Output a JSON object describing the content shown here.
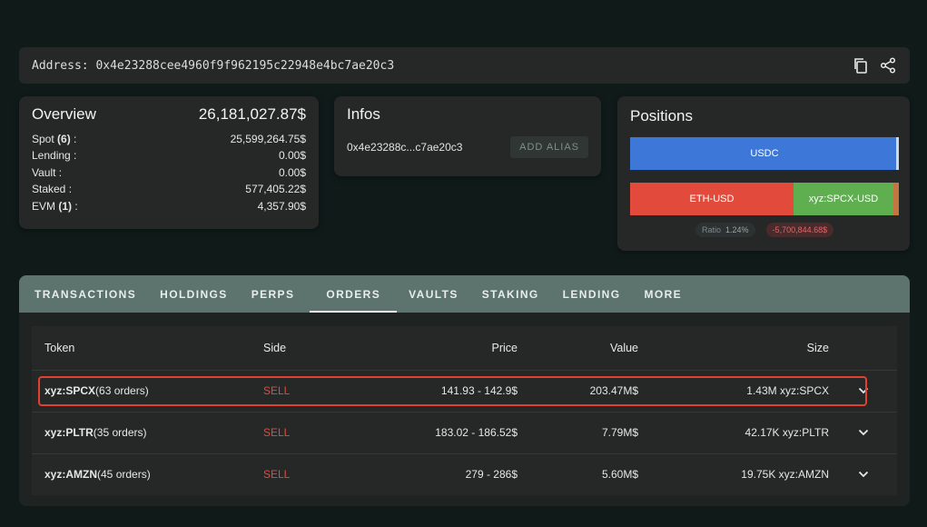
{
  "address": {
    "label": "Address: 0x4e23288cee4960f9f962195c22948e4bc7ae20c3"
  },
  "overview": {
    "title": "Overview",
    "total": "26,181,027.87$",
    "rows": [
      {
        "label_pre": "Spot ",
        "count": "(6)",
        "label_post": " :",
        "value": "25,599,264.75$"
      },
      {
        "label_pre": "Lending :",
        "count": "",
        "label_post": "",
        "value": "0.00$"
      },
      {
        "label_pre": "Vault :",
        "count": "",
        "label_post": "",
        "value": "0.00$"
      },
      {
        "label_pre": "Staked :",
        "count": "",
        "label_post": "",
        "value": "577,405.22$"
      },
      {
        "label_pre": "EVM ",
        "count": "(1)",
        "label_post": " :",
        "value": "4,357.90$"
      }
    ]
  },
  "infos": {
    "title": "Infos",
    "short_address": "0x4e23288c...c7ae20c3",
    "alias_button": "ADD ALIAS"
  },
  "positions": {
    "title": "Positions",
    "usdc_label": "USDC",
    "eth_label": "ETH-USD",
    "spcx_label": "xyz:SPCX-USD",
    "ratio_label": "Ratio",
    "ratio_value": "1.24%",
    "pnl": "-5,700,844.68$",
    "colors": {
      "usdc": "#3d78d8",
      "eth": "#e24a3b",
      "spcx": "#5fae4f"
    }
  },
  "tabs": [
    {
      "label": "TRANSACTIONS"
    },
    {
      "label": "HOLDINGS"
    },
    {
      "label": "PERPS"
    },
    {
      "label": "ORDERS"
    },
    {
      "label": "VAULTS"
    },
    {
      "label": "STAKING"
    },
    {
      "label": "LENDING"
    },
    {
      "label": "MORE"
    }
  ],
  "table": {
    "headers": {
      "token": "Token",
      "side": "Side",
      "price": "Price",
      "value": "Value",
      "size": "Size"
    },
    "rows": [
      {
        "token": "xyz:SPCX",
        "orders": "(63 orders)",
        "side": "SELL",
        "price": "141.93 - 142.9$",
        "value": "203.47M$",
        "size": "1.43M xyz:SPCX"
      },
      {
        "token": "xyz:PLTR",
        "orders": "(35 orders)",
        "side": "SELL",
        "price": "183.02 - 186.52$",
        "value": "7.79M$",
        "size": "42.17K xyz:PLTR"
      },
      {
        "token": "xyz:AMZN",
        "orders": "(45 orders)",
        "side": "SELL",
        "price": "279 - 286$",
        "value": "5.60M$",
        "size": "19.75K xyz:AMZN"
      }
    ]
  }
}
